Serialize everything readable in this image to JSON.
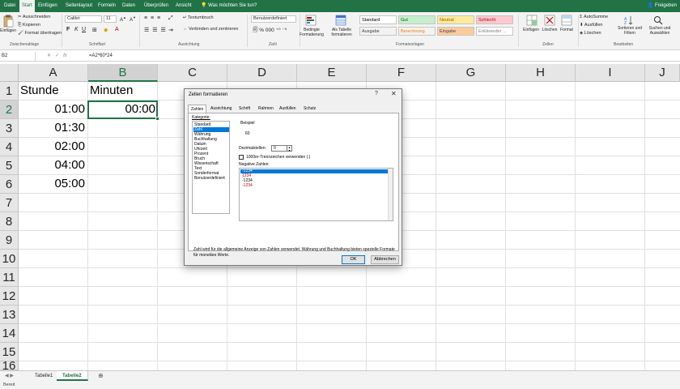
{
  "ribbon_tabs": [
    {
      "label": "Datei",
      "active": false
    },
    {
      "label": "Start",
      "active": true
    },
    {
      "label": "Einfügen",
      "active": false
    },
    {
      "label": "Seitenlayout",
      "active": false
    },
    {
      "label": "Formeln",
      "active": false
    },
    {
      "label": "Daten",
      "active": false
    },
    {
      "label": "Überprüfen",
      "active": false
    },
    {
      "label": "Ansicht",
      "active": false
    }
  ],
  "tell_me": "Was möchten Sie tun?",
  "share": "Freigeben",
  "clipboard": {
    "paste": "Einfügen",
    "cut": "Ausschneiden",
    "copy": "Kopieren",
    "format_painter": "Format übertragen",
    "group": "Zwischenablage"
  },
  "font": {
    "name": "Calibri",
    "size": "11",
    "group": "Schriftart"
  },
  "alignment": {
    "wrap": "Textumbruch",
    "merge": "Verbinden und zentrieren",
    "group": "Ausrichtung"
  },
  "number": {
    "format": "Benutzerdefiniert",
    "group": "Zahl"
  },
  "styles": {
    "conditional": "Bedingte Formatierung",
    "as_table": "Als Tabelle formatieren",
    "cells": [
      {
        "label": "Standard",
        "bg": "#ffffff",
        "color": "#000000"
      },
      {
        "label": "Gut",
        "bg": "#c6efce",
        "color": "#006100"
      },
      {
        "label": "Neutral",
        "bg": "#ffeb9c",
        "color": "#9c5700"
      },
      {
        "label": "Schlecht",
        "bg": "#ffc7ce",
        "color": "#9c0006"
      },
      {
        "label": "Ausgabe",
        "bg": "#f2f2f2",
        "color": "#3f3f3f"
      },
      {
        "label": "Berechnung",
        "bg": "#f2f2f2",
        "color": "#fa7d00"
      },
      {
        "label": "Eingabe",
        "bg": "#ffcc99",
        "color": "#3f3f76"
      },
      {
        "label": "Erklärender ...",
        "bg": "#ffffff",
        "color": "#7f7f7f"
      }
    ],
    "group": "Formatvorlagen"
  },
  "cells_group": {
    "insert": "Einfügen",
    "delete": "Löschen",
    "format": "Format",
    "group": "Zellen"
  },
  "editing": {
    "autosum": "AutoSumme",
    "fill": "Ausfüllen",
    "clear": "Löschen",
    "sort": "Sortieren und Filtern",
    "find": "Suchen und Auswählen",
    "group": "Bearbeiten"
  },
  "formula_bar": {
    "name_box": "B2",
    "fx": "fx",
    "formula": "=A2*60*24"
  },
  "columns": [
    "A",
    "B",
    "C",
    "D",
    "E",
    "F",
    "G",
    "H",
    "I",
    "J"
  ],
  "rows": [
    "1",
    "2",
    "3",
    "4",
    "5",
    "6",
    "7",
    "8",
    "9",
    "10",
    "11",
    "12",
    "13",
    "14",
    "15",
    "16"
  ],
  "cells": {
    "A1": "Stunde",
    "B1": "Minuten",
    "A2": "01:00",
    "B2": "00:00",
    "A3": "01:30",
    "A4": "02:00",
    "A5": "04:00",
    "A6": "05:00"
  },
  "sheets": [
    {
      "label": "Tabelle1",
      "active": false
    },
    {
      "label": "Tabelle2",
      "active": true
    }
  ],
  "status": "Bereit",
  "dialog": {
    "title": "Zellen formatieren",
    "help": "?",
    "close": "✕",
    "tabs": [
      {
        "label": "Zahlen",
        "active": true
      },
      {
        "label": "Ausrichtung",
        "active": false
      },
      {
        "label": "Schrift",
        "active": false
      },
      {
        "label": "Rahmen",
        "active": false
      },
      {
        "label": "Ausfüllen",
        "active": false
      },
      {
        "label": "Schutz",
        "active": false
      }
    ],
    "category_label": "Kategorie:",
    "categories": [
      {
        "label": "Standard",
        "selected": false
      },
      {
        "label": "Zahl",
        "selected": true
      },
      {
        "label": "Währung",
        "selected": false
      },
      {
        "label": "Buchhaltung",
        "selected": false
      },
      {
        "label": "Datum",
        "selected": false
      },
      {
        "label": "Uhrzeit",
        "selected": false
      },
      {
        "label": "Prozent",
        "selected": false
      },
      {
        "label": "Bruch",
        "selected": false
      },
      {
        "label": "Wissenschaft",
        "selected": false
      },
      {
        "label": "Text",
        "selected": false
      },
      {
        "label": "Sonderformat",
        "selected": false
      },
      {
        "label": "Benutzerdefiniert",
        "selected": false
      }
    ],
    "example_label": "Beispiel",
    "example_value": "60",
    "decimals_label": "Dezimalstellen:",
    "decimals_value": "0",
    "thousands_label": "1000er-Trennzeichen verwenden (.)",
    "negative_label": "Negative Zahlen:",
    "negative_numbers": [
      {
        "label": "-1234",
        "selected": true,
        "color": "#ffffff"
      },
      {
        "label": "1234",
        "selected": false,
        "color": "#c00000"
      },
      {
        "label": "-1234",
        "selected": false,
        "color": "#000000"
      },
      {
        "label": "-1234",
        "selected": false,
        "color": "#c00000"
      }
    ],
    "description": "Zahl wird für die allgemeine Anzeige von Zahlen verwendet. Währung und Buchhaltung bieten spezielle Formate für monetäre Werte.",
    "ok": "OK",
    "cancel": "Abbrechen"
  }
}
